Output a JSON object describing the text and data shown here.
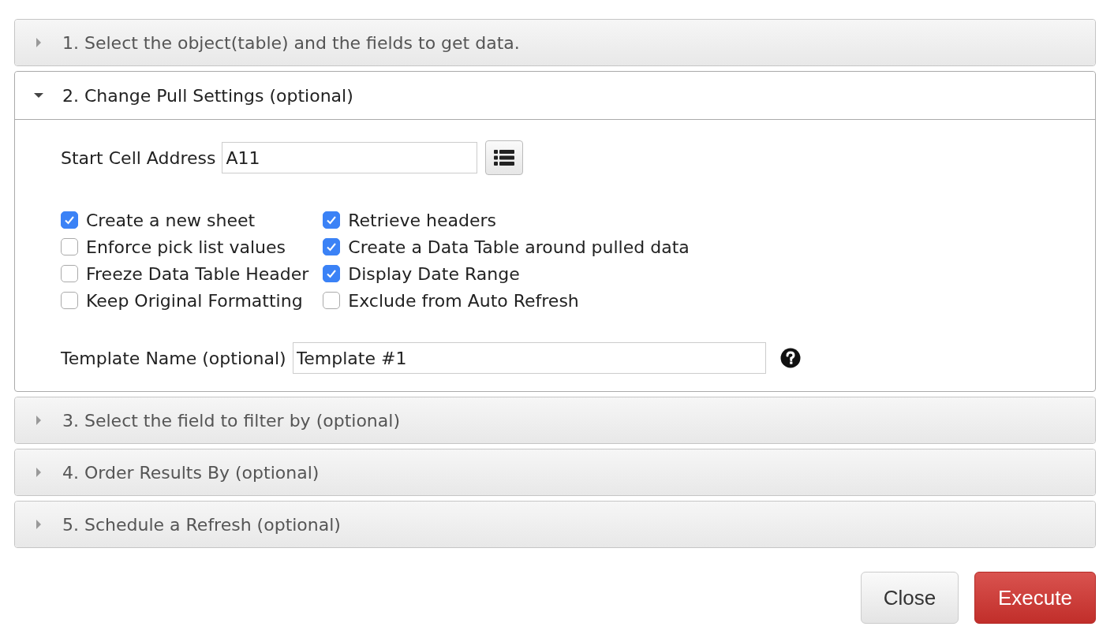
{
  "panels": [
    {
      "title": "1. Select the object(table) and the fields to get data.",
      "expanded": false
    },
    {
      "title": "2. Change Pull Settings (optional)",
      "expanded": true,
      "start_cell": {
        "label": "Start Cell Address",
        "value": "A11"
      },
      "options": [
        {
          "label": "Create a new sheet",
          "checked": true
        },
        {
          "label": "Retrieve headers",
          "checked": true
        },
        {
          "label": "Enforce pick list values",
          "checked": false
        },
        {
          "label": "Create a Data Table around pulled data",
          "checked": true
        },
        {
          "label": "Freeze Data Table Header",
          "checked": false
        },
        {
          "label": "Display Date Range",
          "checked": true
        },
        {
          "label": "Keep Original Formatting",
          "checked": false
        },
        {
          "label": "Exclude from Auto Refresh",
          "checked": false
        }
      ],
      "template": {
        "label": "Template Name (optional)",
        "value": "Template #1"
      }
    },
    {
      "title": "3. Select the field to filter by (optional)",
      "expanded": false
    },
    {
      "title": "4. Order Results By (optional)",
      "expanded": false
    },
    {
      "title": "5. Schedule a Refresh (optional)",
      "expanded": false
    }
  ],
  "buttons": [
    {
      "label": "Close",
      "kind": "default"
    },
    {
      "label": "Execute",
      "kind": "primary"
    }
  ]
}
